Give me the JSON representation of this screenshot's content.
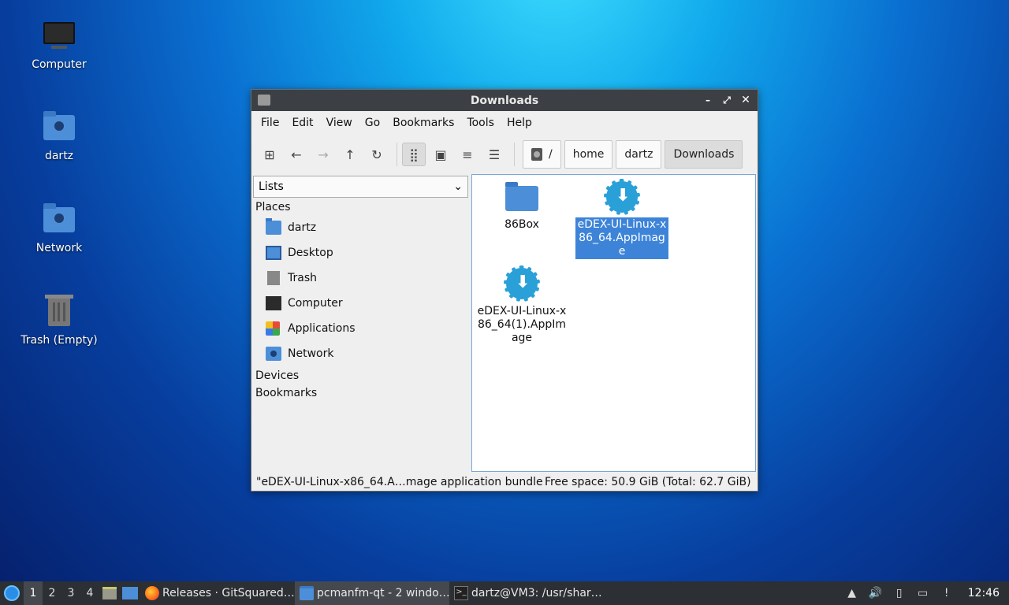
{
  "desktop": {
    "icons": [
      {
        "label": "Computer",
        "icon": "computer-icon"
      },
      {
        "label": "dartz",
        "icon": "home-folder-icon"
      },
      {
        "label": "Network",
        "icon": "network-folder-icon"
      },
      {
        "label": "Trash (Empty)",
        "icon": "trash-icon"
      }
    ]
  },
  "window": {
    "title": "Downloads",
    "controls": {
      "minimize": "–",
      "maximize": "⤢",
      "close": "✕"
    },
    "menu": [
      "File",
      "Edit",
      "View",
      "Go",
      "Bookmarks",
      "Tools",
      "Help"
    ],
    "toolbar": {
      "new_tab": "⊞",
      "back": "←",
      "forward": "→",
      "up": "↑",
      "reload": "↻",
      "view_icons": "⣿",
      "view_thumbnails": "▣",
      "view_compact": "≡",
      "view_detailed": "☰"
    },
    "breadcrumbs": [
      "/",
      "home",
      "dartz",
      "Downloads"
    ],
    "sidepane": {
      "selector": "Lists",
      "selector_arrow": "⌄",
      "places_label": "Places",
      "places": [
        "dartz",
        "Desktop",
        "Trash",
        "Computer",
        "Applications",
        "Network"
      ],
      "devices_label": "Devices",
      "bookmarks_label": "Bookmarks"
    },
    "files": [
      {
        "name": "86Box",
        "type": "folder"
      },
      {
        "name": "eDEX-UI-Linux-x86_64.AppImage",
        "type": "appimage",
        "selected": true
      },
      {
        "name": "eDEX-UI-Linux-x86_64(1).AppImage",
        "type": "appimage"
      }
    ],
    "status": {
      "left": "\"eDEX-UI-Linux-x86_64.A…mage application bundle",
      "right": "Free space: 50.9 GiB (Total: 62.7 GiB)"
    }
  },
  "taskbar": {
    "workspaces": [
      "1",
      "2",
      "3",
      "4"
    ],
    "tasks": [
      {
        "label": "Releases · GitSquared…",
        "icon": "firefox-icon"
      },
      {
        "label": "pcmanfm-qt - 2 windo…",
        "icon": "file-manager-icon"
      },
      {
        "label": "dartz@VM3: /usr/shar…",
        "icon": "terminal-icon"
      }
    ],
    "tray": {
      "updates": "▲",
      "volume": "🔊",
      "clipboard": "▯",
      "network": "▭",
      "notify": "!"
    },
    "clock": "12:46"
  }
}
